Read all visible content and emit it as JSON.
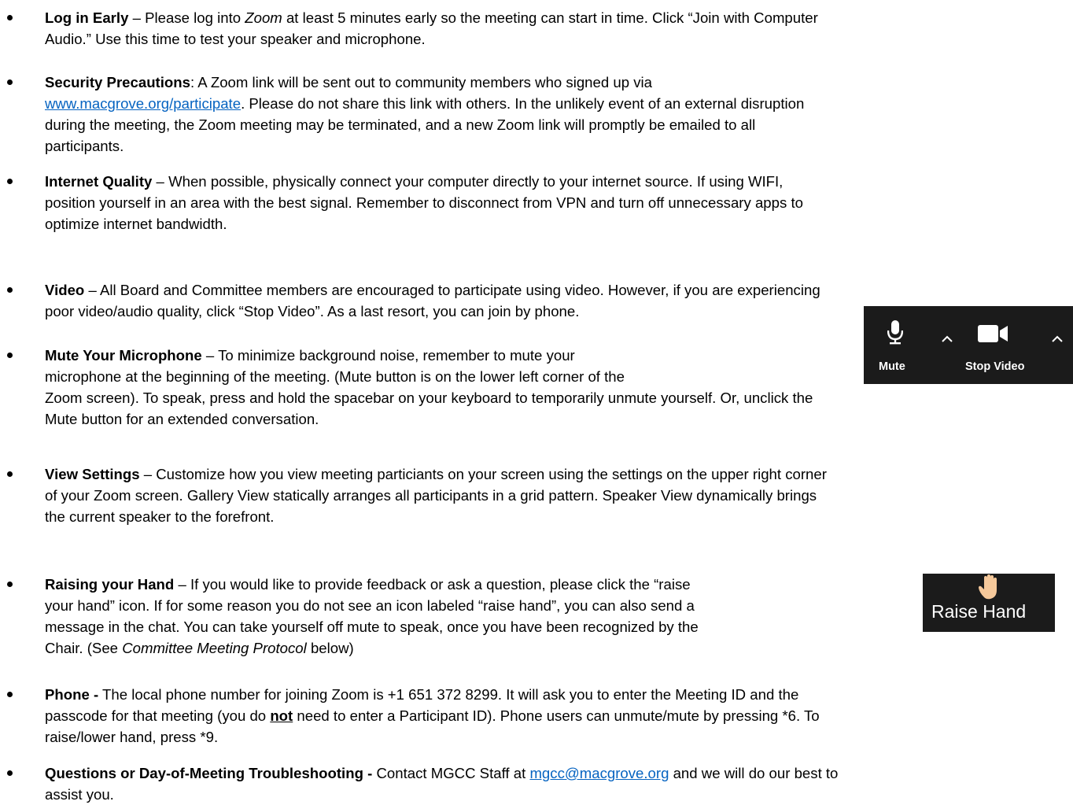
{
  "items": [
    {
      "title": "Log in Early",
      "sep": " – ",
      "l1a": "Please log into ",
      "l1zoom": "Zoom",
      "l1b": " at least 5 minutes early so the meeting can start in time. Click “Join with Computer",
      "l2": "Audio.” Use this time to test your speaker and microphone."
    },
    {
      "title": "Security Precautions",
      "sep": ": ",
      "l1": "A Zoom link will be sent out to community members who signed up via",
      "link": "www.macgrove.org/participate",
      "l2": ". Please do not share this link with others. In the unlikely event of an external disruption",
      "l3": "during the meeting, the Zoom meeting may be terminated, and a new Zoom link will promptly be emailed to all",
      "l4": "participants."
    },
    {
      "title": "Internet Quality",
      "sep": " – ",
      "l1": "When possible, physically connect your computer directly to your internet source. If using WIFI,",
      "l2": "position yourself in an area with the best signal. Remember to disconnect from VPN and turn off unnecessary apps to",
      "l3": "optimize internet bandwidth."
    },
    {
      "title": "Video",
      "sep": " – ",
      "l1": "All Board and Committee members are encouraged to participate using video. However, if you are experiencing",
      "l2": "poor video/audio quality, click “Stop Video”. As a last resort, you can join by phone."
    },
    {
      "title": "Mute Your Microphone",
      "sep": " – ",
      "l1": "To minimize background noise, remember to mute your",
      "l2": "microphone at the beginning of the meeting. (Mute button is on the lower left corner of the",
      "l3": "Zoom screen). To speak, press and hold the spacebar on your keyboard to temporarily unmute yourself. Or, unclick the",
      "l4": "Mute button for an extended conversation."
    },
    {
      "title": "View Settings",
      "sep": " – ",
      "l1": "Customize how you view meeting particiants on your screen using the settings on the upper right corner",
      "l2": "of your Zoom screen. Gallery View statically arranges all participants in a grid pattern. Speaker View dynamically brings",
      "l3": "the current speaker to the forefront."
    },
    {
      "title": "Raising your Hand",
      "sep": " – ",
      "l1": "If you would like to provide feedback or ask a question, please click the “raise",
      "l2": "your hand” icon. If for some reason you do not see an icon labeled “raise hand”, you can also send a",
      "l3": "message in the chat. You can take yourself off mute to speak, once you have been recognized by the",
      "l4a": "Chair. (See ",
      "l4i": "Committee Meeting Protocol",
      "l4b": " below)"
    },
    {
      "title": "Phone -",
      "sep": " ",
      "l1": "The local phone number for joining Zoom is +1 651 372 8299. It will ask you to enter the Meeting ID and the",
      "l2a": "passcode for that meeting (you do ",
      "l2not": "not",
      "l2b": " need to enter a Participant ID). Phone users can unmute/mute by pressing *6. To",
      "l3": "raise/lower hand, press *9."
    },
    {
      "title": "Questions or Day-of-Meeting Troubleshooting -",
      "sep": " ",
      "l1a": "Contact MGCC Staff at ",
      "link": "mgcc@macgrove.org",
      "l1b": " and we will do our best to",
      "l2": "assist you."
    }
  ],
  "toolbar": {
    "mute_label": "Mute",
    "stop_video_label": "Stop Video",
    "bg": "#1b1b1b"
  },
  "raise_hand": {
    "label": "Raise Hand",
    "hand_color": "#f5c89a"
  }
}
